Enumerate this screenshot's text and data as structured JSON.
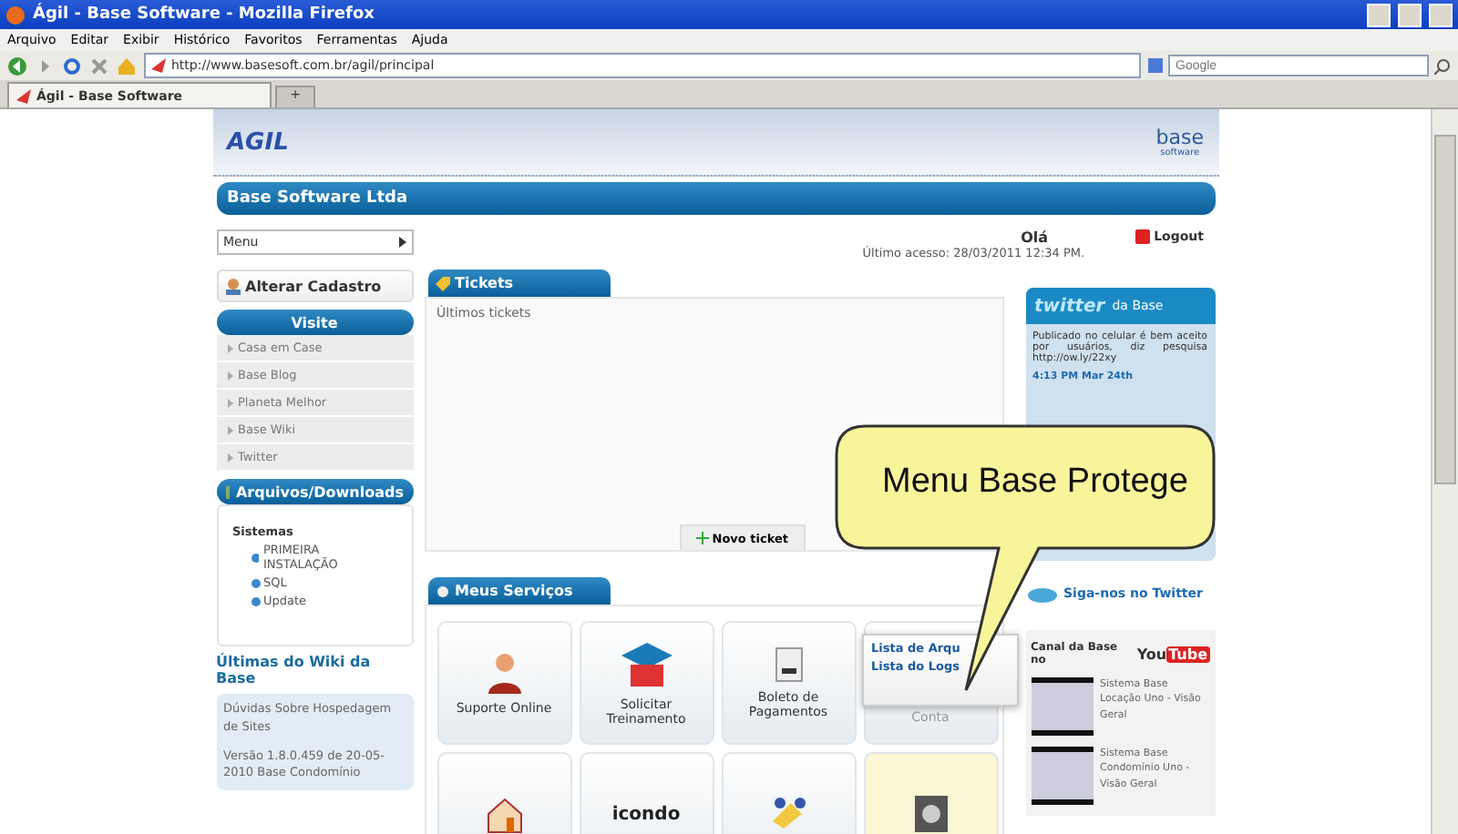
{
  "browser": {
    "title": "Ágil - Base Software - Mozilla Firefox",
    "menu": [
      "Arquivo",
      "Editar",
      "Exibir",
      "Histórico",
      "Favoritos",
      "Ferramentas",
      "Ajuda"
    ],
    "url": "http://www.basesoft.com.br/agil/principal",
    "search": {
      "placeholder": "Google"
    },
    "tabs": [
      {
        "label": "Ágil - Base Software",
        "selected": true
      }
    ],
    "new_tab": "+"
  },
  "page": {
    "logo": "AGIL",
    "base_logo": "base",
    "base_logo_sub": "software",
    "company": "Base Software Ltda",
    "menu_select": "Menu",
    "greeting": "Olá",
    "last_access": "Último acesso: 28/03/2011  12:34 PM.",
    "logout": "Logout",
    "left": {
      "profile": "Alterar Cadastro",
      "visit_title": "Visite",
      "visit": [
        "Casa em Case",
        "Base Blog",
        "Planeta Melhor",
        "Base Wiki",
        "Twitter"
      ],
      "downloads_title": "Arquivos/Downloads",
      "folder": "Sistemas",
      "files": [
        "PRIMEIRA INSTALAÇÃO",
        "SQL",
        "Update"
      ],
      "wiki_title": "Últimas do Wiki da Base",
      "wiki": [
        "Dúvidas Sobre Hospedagem de Sites",
        "Versão 1.8.0.459 de 20-05-2010 Base Condomínio"
      ]
    },
    "tickets": {
      "title": "Tickets",
      "subtitle": "Últimos tickets",
      "new_ticket": "Novo ticket"
    },
    "services": {
      "title": "Meus Serviços",
      "tiles": [
        {
          "kind": "labeled",
          "label": "Suporte Online",
          "selected": false
        },
        {
          "kind": "labeled",
          "label": "Solicitar Treinamento",
          "selected": false
        },
        {
          "kind": "labeled",
          "label": "Boleto de Pagamentos",
          "selected": false
        },
        {
          "kind": "faded",
          "label": "Conta",
          "selected": false
        },
        {
          "kind": "icon",
          "selected": false
        },
        {
          "kind": "logo",
          "label": "icondo",
          "selected": false
        },
        {
          "kind": "icon",
          "selected": false
        },
        {
          "kind": "icon",
          "selected": true
        }
      ]
    },
    "twitter": {
      "logo": "twitter",
      "title": "da Base",
      "tweet": "Publicado no celular é bem aceito por usuários, diz pesquisa http://ow.ly/22xy",
      "time": "4:13 PM Mar 24th",
      "follow": "Siga-nos no Twitter"
    },
    "youtube": {
      "title": "Canal da Base no",
      "logo_you": "You",
      "logo_tube": "Tube",
      "videos": [
        "Sistema Base Locação Uno - Visão Geral",
        "Sistema Base Condomínio Uno - Visão Geral"
      ]
    },
    "popup": [
      "Lista de Arqu",
      "Lista do Logs"
    ],
    "callout": "Menu Base Protege"
  }
}
